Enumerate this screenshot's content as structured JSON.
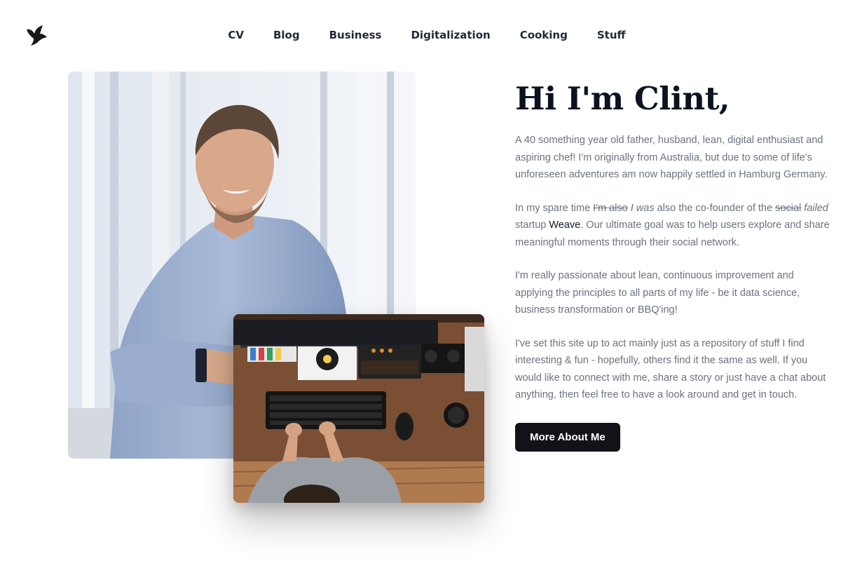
{
  "logo": {
    "icon": "bird-icon"
  },
  "nav": {
    "items": [
      {
        "label": "CV"
      },
      {
        "label": "Blog"
      },
      {
        "label": "Business"
      },
      {
        "label": "Digitalization"
      },
      {
        "label": "Cooking"
      },
      {
        "label": "Stuff"
      }
    ]
  },
  "hero": {
    "title": "Hi I'm Clint,",
    "p1": "A 40 something year old father, husband, lean, digital enthusiast and aspiring chef! I'm originally from Australia, but due to some of life's unforeseen adventures am now happily settled in Hamburg Germany.",
    "p2": {
      "a": "In my spare time ",
      "strike1": "I'm also",
      "b": " ",
      "ital1": "I was",
      "c": " also the co-founder of the ",
      "strike2": "social",
      "d": " ",
      "ital2": "failed",
      "e": " startup ",
      "link": "Weave",
      "f": ". Our ultimate goal was to help users explore and share meaningful moments through their social network."
    },
    "p3": "I'm really passionate about lean, continuous improvement and applying the principles to all parts of my life - be it data science, business transformation or BBQ'ing!",
    "p4": "I've set this site up to act mainly just as a repository of stuff I find interesting & fun - hopefully, others find it the same as well. If you would like to connect with me, share a story or just have a chat about anything, then feel free to have a look around and get in touch.",
    "cta": "More About Me"
  },
  "colors": {
    "heading": "#0b1220",
    "body_text": "#6b7280",
    "button_bg": "#111319",
    "button_text": "#ffffff"
  }
}
